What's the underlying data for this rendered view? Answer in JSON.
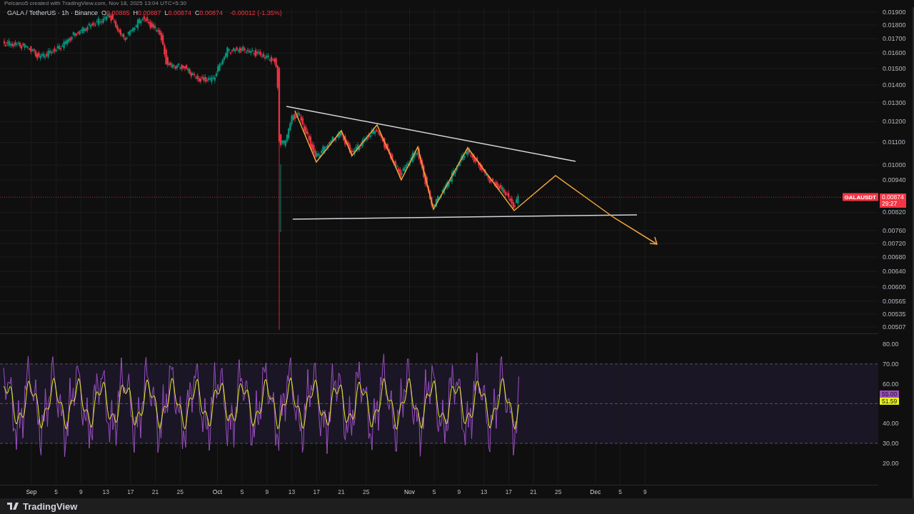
{
  "caption": "Pelcano5 created with TradingView.com, Nov 18, 2025 13:04 UTC+5:30",
  "symbol_header": {
    "title": "GALA / TetherUS · 1h · Binance",
    "ohlc": [
      {
        "letter": "O",
        "value": "0.00885"
      },
      {
        "letter": "H",
        "value": "0.00887"
      },
      {
        "letter": "L",
        "value": "0.00874"
      },
      {
        "letter": "C",
        "value": "0.00874"
      }
    ],
    "change": "-0.00012 (-1.35%)"
  },
  "price_axis": {
    "labels": [
      "0.01900",
      "0.01800",
      "0.01700",
      "0.01600",
      "0.01500",
      "0.01400",
      "0.01300",
      "0.01200",
      "0.01100",
      "0.01000",
      "0.00940",
      "0.00820",
      "0.00760",
      "0.00720",
      "0.00680",
      "0.00640",
      "0.00600",
      "0.00565",
      "0.00535",
      "0.00507"
    ]
  },
  "last_price": {
    "symbol": "GALAUSDT",
    "price": "0.00874",
    "countdown": "29:27"
  },
  "rsi_axis": {
    "labels": [
      "80.00",
      "70.00",
      "60.00",
      "40.00",
      "30.00",
      "20.00"
    ]
  },
  "rsi_tags": [
    {
      "text": "55.00",
      "color": "#9c4fc0"
    },
    {
      "text": "51.59",
      "color": "#e6f01e"
    }
  ],
  "time_axis": [
    {
      "label": "Sep",
      "kind": "month"
    },
    {
      "label": "5",
      "kind": "day"
    },
    {
      "label": "9",
      "kind": "day"
    },
    {
      "label": "13",
      "kind": "day"
    },
    {
      "label": "17",
      "kind": "day"
    },
    {
      "label": "21",
      "kind": "day"
    },
    {
      "label": "25",
      "kind": "day"
    },
    {
      "label": "Oct",
      "kind": "month"
    },
    {
      "label": "5",
      "kind": "day"
    },
    {
      "label": "9",
      "kind": "day"
    },
    {
      "label": "13",
      "kind": "day"
    },
    {
      "label": "17",
      "kind": "day"
    },
    {
      "label": "21",
      "kind": "day"
    },
    {
      "label": "25",
      "kind": "day"
    },
    {
      "label": "Nov",
      "kind": "month"
    },
    {
      "label": "5",
      "kind": "day"
    },
    {
      "label": "9",
      "kind": "day"
    },
    {
      "label": "13",
      "kind": "day"
    },
    {
      "label": "17",
      "kind": "day"
    },
    {
      "label": "21",
      "kind": "day"
    },
    {
      "label": "25",
      "kind": "day"
    },
    {
      "label": "Dec",
      "kind": "month"
    },
    {
      "label": "5",
      "kind": "day"
    },
    {
      "label": "9",
      "kind": "day"
    }
  ],
  "footer": {
    "brand": "TradingView"
  }
}
